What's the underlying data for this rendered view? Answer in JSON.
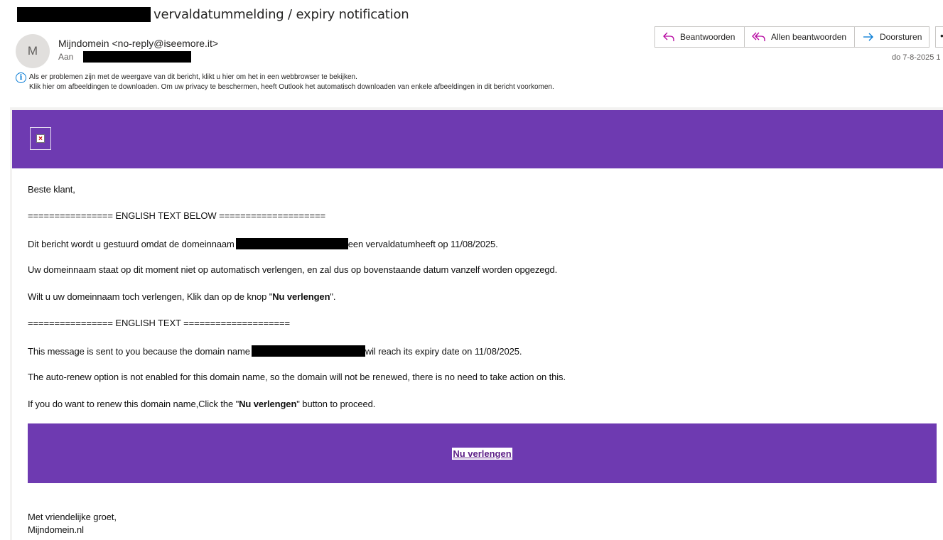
{
  "email": {
    "subject": "vervaldatummelding / expiry notification",
    "sender_initial": "M",
    "sender": "Mijndomein <no-reply@iseemore.it>",
    "to_label": "Aan",
    "date": "do 7-8-2025 1"
  },
  "actions": {
    "reply": "Beantwoorden",
    "reply_all": "Allen beantwoorden",
    "forward": "Doorsturen",
    "more": "•"
  },
  "info": {
    "line1": "Als er problemen zijn met de weergave van dit bericht, klikt u hier om het in een webbrowser te bekijken.",
    "line2": "Klik hier om afbeeldingen te downloaden. Om uw privacy te beschermen, heeft Outlook het automatisch downloaden van enkele afbeeldingen in dit bericht voorkomen."
  },
  "body": {
    "greeting": "Beste klant,",
    "sep_english_below": "================ ENGLISH TEXT BELOW ====================",
    "nl_line1_a": "Dit bericht wordt u gestuurd omdat de domeinnaam",
    "nl_line1_b": "een vervaldatumheeft op 11/08/2025.",
    "nl_line2": "Uw domeinnaam staat op dit moment niet op automatisch verlengen, en zal dus op bovenstaande datum vanzelf worden opgezegd.",
    "nl_line3_a": "Wilt u uw domeinnaam toch verlengen, Klik dan op de knop \"",
    "nl_line3_bold": "Nu verlengen",
    "nl_line3_b": "\".",
    "sep_english": "================ ENGLISH TEXT ====================",
    "en_line1_a": "This message is sent to you because the domain name",
    "en_line1_b": "wil reach its expiry date on 11/08/2025.",
    "en_line2": "The auto-renew option is not enabled for this domain name, so the domain will not be renewed, there is no need to take action on this.",
    "en_line3_a": "If you do want to renew this domain name,Click the \"",
    "en_line3_bold": "Nu verlengen",
    "en_line3_b": "\" button to proceed.",
    "cta": "Nu verlengen",
    "closing": "Met vriendelijke groet,",
    "signature": "Mijndomein.nl"
  },
  "colors": {
    "brand_purple": "#6e3ab1",
    "cta_text": "#5c1f87",
    "info_blue": "#0078d4"
  },
  "icons": {
    "reply": "reply-arrow-icon",
    "reply_all": "reply-all-arrow-icon",
    "forward": "forward-arrow-icon",
    "info": "info-icon",
    "broken_image": "broken-image-icon"
  }
}
